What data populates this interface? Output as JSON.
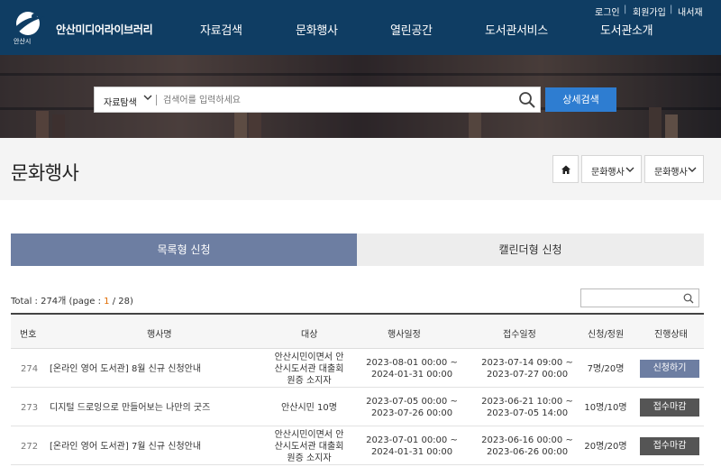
{
  "header": {
    "logo_text": "안산시",
    "brand": "안산미디어라이브러리",
    "nav": [
      "자료검색",
      "문화행사",
      "열린공간",
      "도서관서비스",
      "도서관소개"
    ],
    "util": [
      "로그인",
      "회원가입",
      "내서재"
    ]
  },
  "search": {
    "category": "자료탐색",
    "placeholder": "검색어를 입력하세요",
    "advanced_label": "상세검색"
  },
  "page": {
    "title": "문화행사",
    "breadcrumb": [
      "문화행사",
      "문화행사"
    ]
  },
  "tabs": [
    {
      "label": "목록형 신청",
      "active": true
    },
    {
      "label": "캘린더형 신청",
      "active": false
    }
  ],
  "list": {
    "total_prefix": "Total : 274개 (page : ",
    "page_current": "1",
    "page_suffix": " / 28)"
  },
  "table": {
    "headers": [
      "번호",
      "행사명",
      "대상",
      "행사일정",
      "접수일정",
      "신청/정원",
      "진행상태"
    ],
    "rows": [
      {
        "no": "274",
        "title": "[온라인 영어 도서관] 8월 신규 신청안내",
        "target": [
          "안산시민이면서 안",
          "산시도서관 대출회",
          "원증 소지자"
        ],
        "event": [
          "2023-08-01 00:00 ~",
          "2024-01-31 00:00"
        ],
        "reception": [
          "2023-07-14 09:00 ~",
          "2023-07-27 00:00"
        ],
        "capacity": "7명/20명",
        "status": "신청하기",
        "status_type": "open"
      },
      {
        "no": "273",
        "title": "디지털 드로잉으로 만들어보는 나만의 굿즈",
        "target": [
          "안산시민 10명"
        ],
        "event": [
          "2023-07-05 00:00 ~",
          "2023-07-26 00:00"
        ],
        "reception": [
          "2023-06-21 10:00 ~",
          "2023-07-05 14:00"
        ],
        "capacity": "10명/10명",
        "status": "접수마감",
        "status_type": "closed"
      },
      {
        "no": "272",
        "title": "[온라인 영어 도서관] 7월 신규 신청안내",
        "target": [
          "안산시민이면서 안",
          "산시도서관 대출회",
          "원증 소지자"
        ],
        "event": [
          "2023-07-01 00:00 ~",
          "2024-01-31 00:00"
        ],
        "reception": [
          "2023-06-16 00:00 ~",
          "2023-06-26 00:00"
        ],
        "capacity": "20명/20명",
        "status": "접수마감",
        "status_type": "closed"
      }
    ]
  },
  "colors": {
    "header_bg": "#0f3d63",
    "accent_blue": "#2e7dd1",
    "tab_active": "#6d7ea2",
    "status_closed": "#555555",
    "page_highlight": "#e06b00"
  },
  "icons": {
    "search": "search-icon",
    "home": "home-icon",
    "chevron": "chevron-down-icon"
  }
}
